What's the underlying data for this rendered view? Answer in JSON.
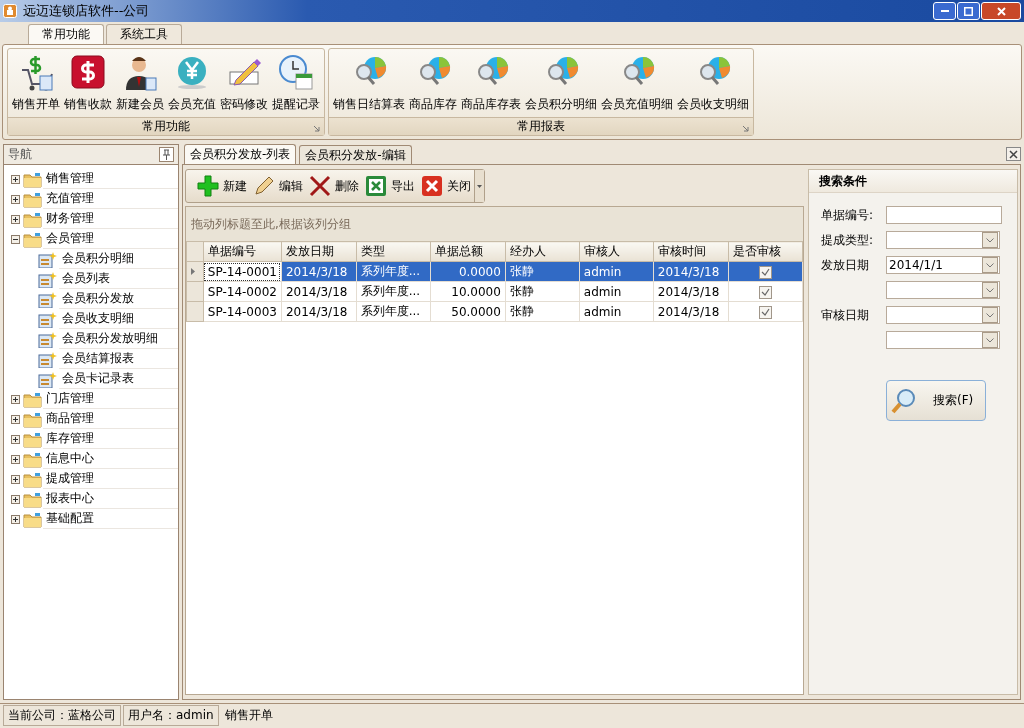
{
  "window": {
    "title": "远迈连锁店软件--公司"
  },
  "ribbon": {
    "tabs": [
      {
        "label": "常用功能",
        "selected": true
      },
      {
        "label": "系统工具",
        "selected": false
      }
    ],
    "groups": [
      {
        "label": "常用功能",
        "buttons": [
          {
            "label": "销售开单",
            "kind": "cart"
          },
          {
            "label": "销售收款",
            "kind": "dollar"
          },
          {
            "label": "新建会员",
            "kind": "person"
          },
          {
            "label": "会员充值",
            "kind": "yen"
          },
          {
            "label": "密码修改",
            "kind": "pencil"
          },
          {
            "label": "提醒记录",
            "kind": "clock"
          }
        ]
      },
      {
        "label": "常用报表",
        "buttons": [
          {
            "label": "销售日结算表",
            "kind": "report"
          },
          {
            "label": "商品库存",
            "kind": "report"
          },
          {
            "label": "商品库存表",
            "kind": "report"
          },
          {
            "label": "会员积分明细",
            "kind": "report"
          },
          {
            "label": "会员充值明细",
            "kind": "report"
          },
          {
            "label": "会员收支明细",
            "kind": "report"
          }
        ]
      }
    ]
  },
  "nav": {
    "title": "导航",
    "items": [
      {
        "label": "销售管理",
        "expanded": false
      },
      {
        "label": "充值管理",
        "expanded": false
      },
      {
        "label": "财务管理",
        "expanded": false
      },
      {
        "label": "会员管理",
        "expanded": true,
        "children": [
          {
            "label": "会员积分明细"
          },
          {
            "label": "会员列表"
          },
          {
            "label": "会员积分发放"
          },
          {
            "label": "会员收支明细"
          },
          {
            "label": "会员积分发放明细"
          },
          {
            "label": "会员结算报表"
          },
          {
            "label": "会员卡记录表"
          }
        ]
      },
      {
        "label": "门店管理",
        "expanded": false
      },
      {
        "label": "商品管理",
        "expanded": false
      },
      {
        "label": "库存管理",
        "expanded": false
      },
      {
        "label": "信息中心",
        "expanded": false
      },
      {
        "label": "提成管理",
        "expanded": false
      },
      {
        "label": "报表中心",
        "expanded": false
      },
      {
        "label": "基础配置",
        "expanded": false
      }
    ]
  },
  "doc_tabs": [
    {
      "label": "会员积分发放-列表",
      "selected": true
    },
    {
      "label": "会员积分发放-编辑",
      "selected": false
    }
  ],
  "toolbar": [
    {
      "label": "新建",
      "kind": "add"
    },
    {
      "label": "编辑",
      "kind": "edit"
    },
    {
      "label": "删除",
      "kind": "delete"
    },
    {
      "label": "导出",
      "kind": "excel"
    },
    {
      "label": "关闭",
      "kind": "close"
    }
  ],
  "group_hint": "拖动列标题至此,根据该列分组",
  "table": {
    "columns": [
      "单据编号",
      "发放日期",
      "类型",
      "单据总额",
      "经办人",
      "审核人",
      "审核时间",
      "是否审核"
    ],
    "rows": [
      {
        "selected": true,
        "cells": [
          "SP-14-0001",
          "2014/3/18",
          "系列年度...",
          "0.0000",
          "张静",
          "admin",
          "2014/3/18"
        ],
        "checked": true
      },
      {
        "selected": false,
        "cells": [
          "SP-14-0002",
          "2014/3/18",
          "系列年度...",
          "10.0000",
          "张静",
          "admin",
          "2014/3/18"
        ],
        "checked": true
      },
      {
        "selected": false,
        "cells": [
          "SP-14-0003",
          "2014/3/18",
          "系列年度...",
          "50.0000",
          "张静",
          "admin",
          "2014/3/18"
        ],
        "checked": true
      }
    ]
  },
  "search_panel": {
    "title": "搜索条件",
    "fields": [
      {
        "label": "单据编号:",
        "kind": "text"
      },
      {
        "label": "提成类型:",
        "kind": "combo"
      },
      {
        "label": "发放日期",
        "kind": "combo",
        "value": "2014/1/1"
      },
      {
        "kind": "combo"
      },
      {
        "label": "审核日期",
        "kind": "combo"
      },
      {
        "kind": "combo"
      }
    ],
    "button": "搜索(F)"
  },
  "status_bar": [
    "当前公司：蓝格公司",
    "用户名：admin",
    "销售开单"
  ]
}
